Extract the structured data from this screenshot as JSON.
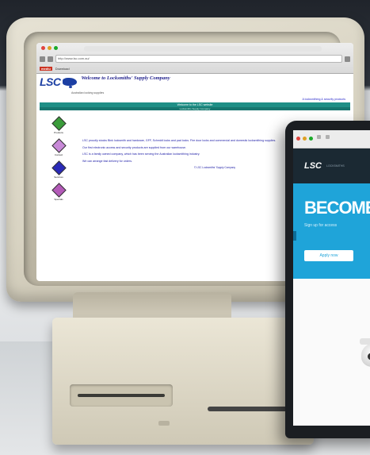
{
  "crt_browser": {
    "url": "http://www.lsc.com.au/",
    "download_logo": "mediu",
    "download_text": "Download",
    "logo": "LSC",
    "welcome": "Welcome to Locksmiths' Supply Company",
    "tagline": "Australian locking supplies",
    "redline": "A locksmithing & security products",
    "teal_bar": "Welcome to the LSC website",
    "sub_bar": "Locksmiths Supply Company",
    "nav": [
      {
        "label": "Products",
        "icon": "diamond-green-icon"
      },
      {
        "label": "Contact",
        "icon": "diamond-lilac-icon"
      },
      {
        "label": "Services",
        "icon": "diamond-blue-icon"
      },
      {
        "label": "Specials",
        "icon": "diamond-purple-icon"
      }
    ],
    "paragraphs": [
      "LSC proudly stocks Bink locksmith and hardware, GFF, Schmidt locks and pad locks. Fire door locks and commercial and domestic locksmithing supplies.",
      "Our first electronic access and security products are supplied from our warehouse.",
      "LSC is a family owned company, which has been serving the Australian locksmithing industry.",
      "We can arrange fast delivery for orders."
    ],
    "footer": "© LSC Locksmiths' Supply Company"
  },
  "laptop_site": {
    "logo": "LSC",
    "logo_sub": "LOCKSMITHS",
    "hero_title": "BECOME",
    "hero_sub": "Sign up for access",
    "hero_button": "Apply now"
  },
  "colors": {
    "lsc_blue": "#1c3fa3",
    "teal": "#1f8f86",
    "hero_blue": "#1fa4d9",
    "nav_dark": "#1b2933"
  }
}
